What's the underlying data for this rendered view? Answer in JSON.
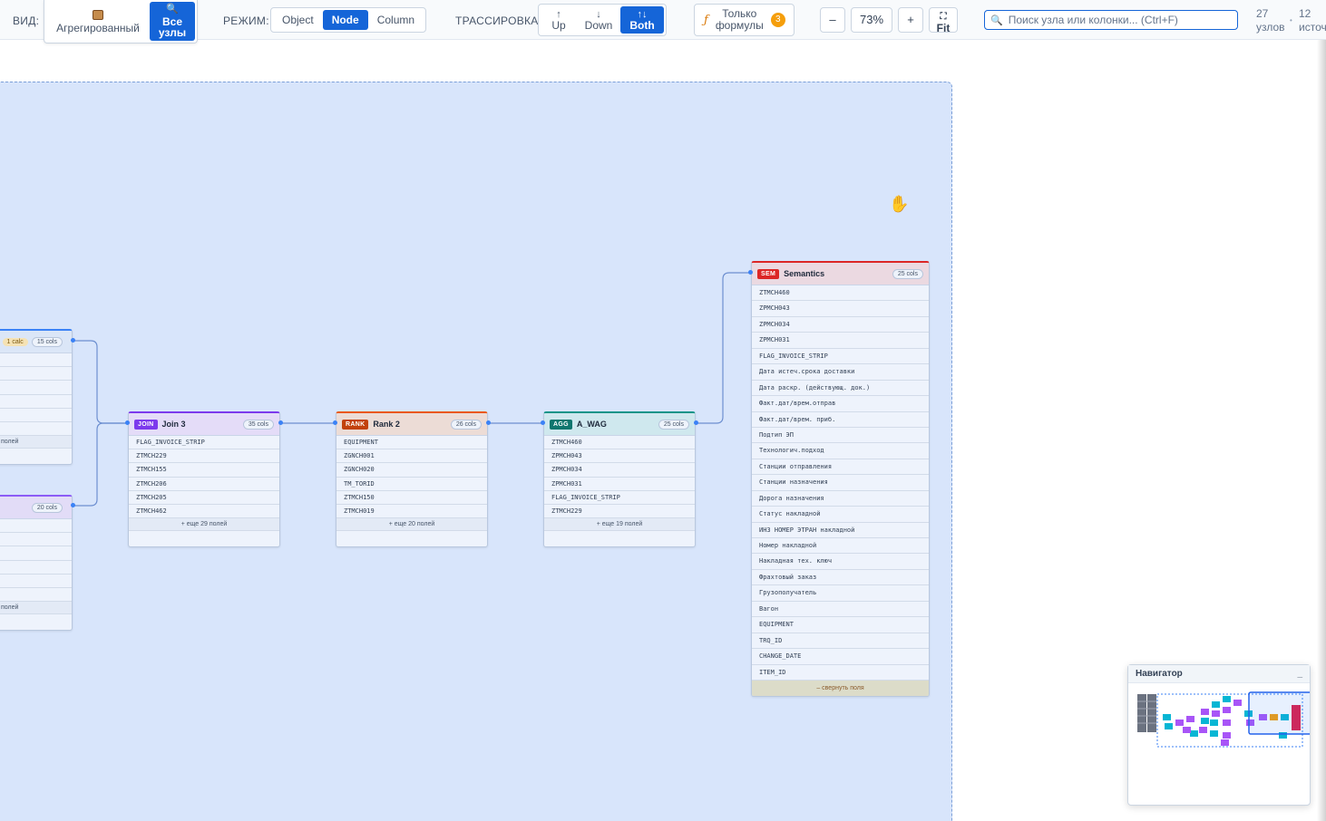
{
  "toolbar": {
    "view_label": "ВИД:",
    "view_options": [
      {
        "icon": "box-icon",
        "label": "Агрегированный",
        "active": false
      },
      {
        "icon": "magnifier-icon",
        "label": "Все узлы",
        "active": true
      }
    ],
    "mode_label": "РЕЖИМ:",
    "mode_options": [
      "Object",
      "Node",
      "Column"
    ],
    "mode_active": "Node",
    "trace_label": "ТРАССИРОВКА:",
    "trace_options": [
      {
        "arrow": "↑",
        "label": "Up"
      },
      {
        "arrow": "↓",
        "label": "Down"
      },
      {
        "arrow": "↑↓",
        "label": "Both"
      }
    ],
    "trace_active": "Both",
    "formula_icon": "ƒ",
    "formula_label_1": "Только",
    "formula_label_2": "формулы",
    "formula_count": "3",
    "zoom_out": "–",
    "zoom_level": "73%",
    "zoom_in": "+",
    "fit_icon": "⛶",
    "fit_label": "Fit",
    "search_placeholder": "Поиск узла или колонки... (Ctrl+F)",
    "stats": [
      {
        "value": "27",
        "label": "узлов"
      },
      {
        "value": "12",
        "label": "источ"
      }
    ]
  },
  "nodes": {
    "partial_top": {
      "calc": "1 calc",
      "cols": "15 cols",
      "more": "полей"
    },
    "partial_bottom": {
      "cols": "20 cols",
      "more": "полей"
    },
    "join3": {
      "tag": "JOIN",
      "title": "Join 3",
      "cols": "35 cols",
      "rows": [
        "FLAG_INVOICE_STRIP",
        "ZTMCH229",
        "ZTMCH155",
        "ZTMCH206",
        "ZTMCH205",
        "ZTMCH462"
      ],
      "more": "+ еще 29 полей",
      "color": "#7c3aed"
    },
    "rank2": {
      "tag": "RANK",
      "title": "Rank 2",
      "cols": "26 cols",
      "rows": [
        "EQUIPMENT",
        "ZGNCH001",
        "ZGNCH020",
        "TM_TORID",
        "ZTMCH150",
        "ZTMCH019"
      ],
      "more": "+ еще 20 полей",
      "color": "#c2410c"
    },
    "awag": {
      "tag": "AGG",
      "title": "A_WAG",
      "cols": "25 cols",
      "rows": [
        "ZTMCH460",
        "ZPMCH043",
        "ZPMCH034",
        "ZPMCH031",
        "FLAG_INVOICE_STRIP",
        "ZTMCH229"
      ],
      "more": "+ еще 19 полей",
      "color": "#0f766e"
    },
    "semantics": {
      "tag": "SEM",
      "title": "Semantics",
      "cols": "25 cols",
      "rows": [
        "ZTMCH460",
        "ZPMCH043",
        "ZPMCH034",
        "ZPMCH031",
        "FLAG_INVOICE_STRIP",
        "Дата истеч.срока доставки",
        "Дата раскр. (действующ. док.)",
        "Факт.дат/врем.отправ",
        "Факт.дат/врем. приб.",
        "Подтип ЭП",
        "Технологич.подход",
        "Станции отправления",
        "Станции назначения",
        "Дорога назначения",
        "Статус накладной",
        "ИНЗ НОМЕР ЭТРАН накладной",
        "Номер накладной",
        "Накладная тех. ключ",
        "Фрахтовый заказ",
        "Грузополучатель",
        "Вагон",
        "EQUIPMENT",
        "TRQ_ID",
        "CHANGE_DATE",
        "ITEM_ID"
      ],
      "collapse": "– свернуть поля",
      "color": "#dc2626"
    }
  },
  "navigator": {
    "title": "Навигатор",
    "minimize": "_"
  }
}
